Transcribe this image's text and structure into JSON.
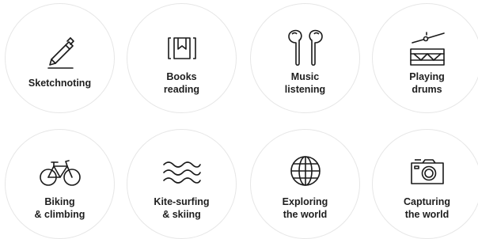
{
  "hobbies": [
    {
      "label": "Sketchnoting",
      "icon": "pen-icon"
    },
    {
      "label": "Books\nreading",
      "icon": "book-icon"
    },
    {
      "label": "Music\nlistening",
      "icon": "earbuds-icon"
    },
    {
      "label": "Playing\ndrums",
      "icon": "drum-icon"
    },
    {
      "label": "Biking\n& climbing",
      "icon": "bicycle-icon"
    },
    {
      "label": "Kite-surfing\n& skiing",
      "icon": "waves-icon"
    },
    {
      "label": "Exploring\nthe world",
      "icon": "globe-icon"
    },
    {
      "label": "Capturing\nthe world",
      "icon": "camera-icon"
    }
  ]
}
